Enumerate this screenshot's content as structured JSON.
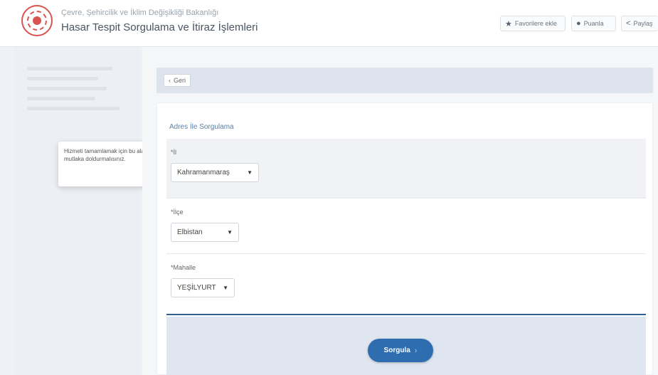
{
  "header": {
    "ministry": "Çevre, Şehircilik ve İklim Değişikliği Bakanlığı",
    "service_title": "Hasar Tespit Sorgulama ve İtiraz İşlemleri",
    "buttons": {
      "favorite": "Favorilere ekle",
      "rate": "Puanla",
      "share": "Paylaş"
    },
    "icons": {
      "favorite": "star-icon",
      "rate": "speech-bubble-icon",
      "share": "share-icon"
    }
  },
  "tooltip": {
    "text": "Hizmeti tamamlamak için bu alanı mutlaka doldurmalısınız."
  },
  "back": {
    "label": "Geri"
  },
  "form": {
    "section_title": "Adres İle Sorgulama",
    "il": {
      "label": "*İl",
      "value": "Kahramanmaraş"
    },
    "ilce": {
      "label": "*İlçe",
      "value": "Elbistan"
    },
    "mahalle": {
      "label": "*Mahalle",
      "value": "YEŞİLYURT"
    },
    "submit_label": "Sorgula"
  },
  "colors": {
    "accent": "#2e6db0",
    "brand": "#d9534f"
  }
}
